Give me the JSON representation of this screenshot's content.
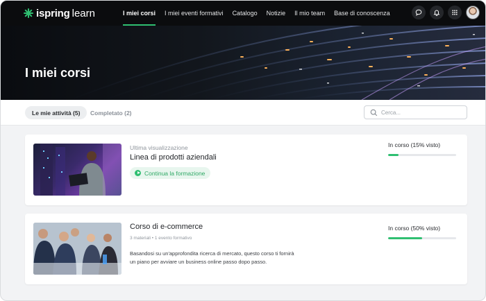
{
  "header": {
    "brand": "ispring",
    "brand_suffix": "learn",
    "nav": [
      {
        "label": "I miei corsi",
        "active": true
      },
      {
        "label": "I miei eventi formativi",
        "active": false
      },
      {
        "label": "Catalogo",
        "active": false
      },
      {
        "label": "Notizie",
        "active": false
      },
      {
        "label": "Il mio team",
        "active": false
      },
      {
        "label": "Base di conoscenza",
        "active": false
      }
    ],
    "icons": [
      "chat-icon",
      "bell-icon",
      "apps-grid-icon"
    ]
  },
  "banner": {
    "title": "I miei corsi"
  },
  "tabs": [
    {
      "label": "Le mie attività (5)",
      "active": true
    },
    {
      "label": "Completato (2)",
      "active": false
    }
  ],
  "search": {
    "placeholder": "Cerca..."
  },
  "courses": [
    {
      "last_viewed_label": "Ultima visualizzazione",
      "title": "Linea di prodotti aziendali",
      "resume_label": "Continua la formazione",
      "status": "In corso (15% visto)",
      "progress": 0.15
    },
    {
      "title": "Corso di e-commerce",
      "meta": "3 materiali • 1 evento formativo",
      "description": "Basandosi su un'approfondita ricerca di mercato, questo corso ti fornirà un piano per avviare un business online passo dopo passo.",
      "status": "In corso (50% visto)",
      "progress": 0.5
    }
  ],
  "colors": {
    "accent": "#2fbf71",
    "topbar": "#0b0c0e"
  }
}
